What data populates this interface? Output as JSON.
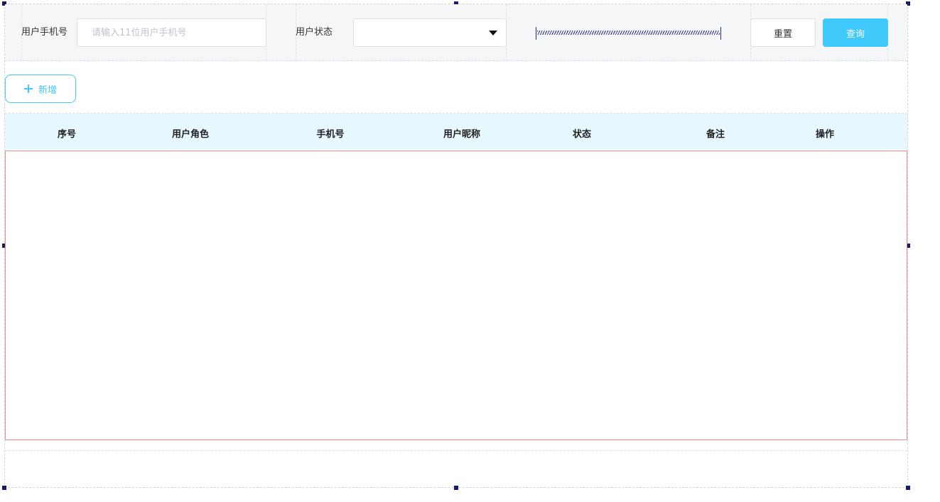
{
  "filters": {
    "phone_label": "用户手机号",
    "phone_value": "",
    "phone_placeholder": "请输入11位用户手机号",
    "status_label": "用户状态",
    "status_value": "",
    "reset_label": "重置",
    "query_label": "查询"
  },
  "toolbar": {
    "add_label": "新增"
  },
  "table": {
    "columns": [
      "序号",
      "用户角色",
      "手机号",
      "用户昵称",
      "状态",
      "备注",
      "操作"
    ],
    "rows": []
  },
  "colors": {
    "accent": "#40c9fb",
    "header_bg": "#e6f7fd",
    "filter_bg": "#f5f6f8",
    "selection_border": "#f08a8a",
    "handle": "#1a1a66"
  },
  "icons": {
    "add": "plus-icon",
    "select": "caret-down-icon"
  }
}
